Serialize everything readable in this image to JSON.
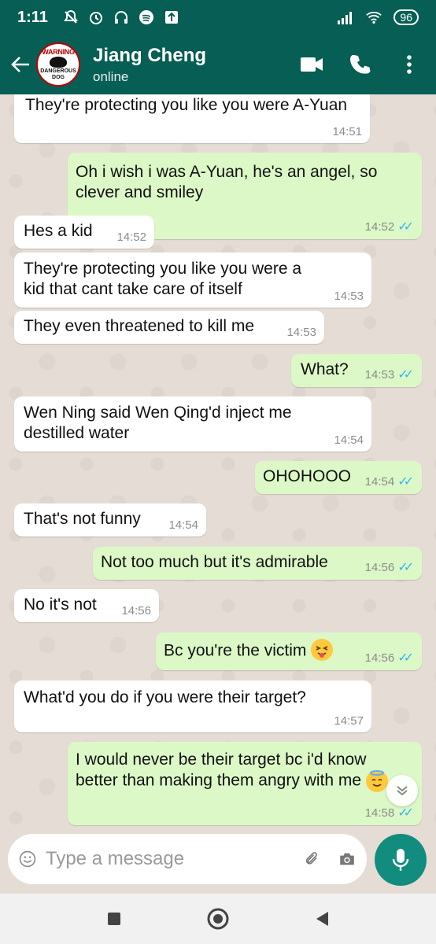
{
  "status_bar": {
    "time": "1:11",
    "battery": "96"
  },
  "header": {
    "contact_name": "Jiang Cheng",
    "contact_status": "online",
    "avatar_text_top": "WARNING",
    "avatar_text_bottom": "DANGEROUS DOG"
  },
  "messages": [
    {
      "dir": "in",
      "text": "They're protecting you like you were A-Yuan",
      "time": "14:51"
    },
    {
      "dir": "out",
      "text": "Oh i wish i was A-Yuan, he's an angel, so clever and smiley",
      "time": "14:52",
      "status": "read"
    },
    {
      "dir": "in",
      "text": "Hes a kid",
      "time": "14:52"
    },
    {
      "dir": "in",
      "text": "They're protecting you like you were a kid that cant take care of itself",
      "time": "14:53"
    },
    {
      "dir": "in",
      "text": "They even threatened to kill me",
      "time": "14:53"
    },
    {
      "dir": "out",
      "text": "What?",
      "time": "14:53",
      "status": "read"
    },
    {
      "dir": "in",
      "text": "Wen Ning said Wen Qing'd inject me destilled water",
      "time": "14:54"
    },
    {
      "dir": "out",
      "text": "OHOHOOO",
      "time": "14:54",
      "status": "read"
    },
    {
      "dir": "in",
      "text": "That's not funny",
      "time": "14:54"
    },
    {
      "dir": "out",
      "text": "Not too much but it's admirable",
      "time": "14:56",
      "status": "read"
    },
    {
      "dir": "in",
      "text": "No it's not",
      "time": "14:56"
    },
    {
      "dir": "out",
      "text": "Bc you're the victim",
      "time": "14:56",
      "status": "read",
      "emoji": "tongue-wink-emoji"
    },
    {
      "dir": "in",
      "text": "What'd you do if you were their target?",
      "time": "14:57"
    },
    {
      "dir": "out",
      "text": "I would never be their target bc i'd know better than making them angry with me",
      "time": "14:58",
      "status": "read",
      "emoji": "halo-emoji"
    }
  ],
  "composer": {
    "placeholder": "Type a message"
  },
  "colors": {
    "header": "#075e54",
    "outgoing_bubble": "#dcf8c6",
    "incoming_bubble": "#ffffff",
    "accent": "#128c7e",
    "read_ticks": "#34b7f1"
  }
}
